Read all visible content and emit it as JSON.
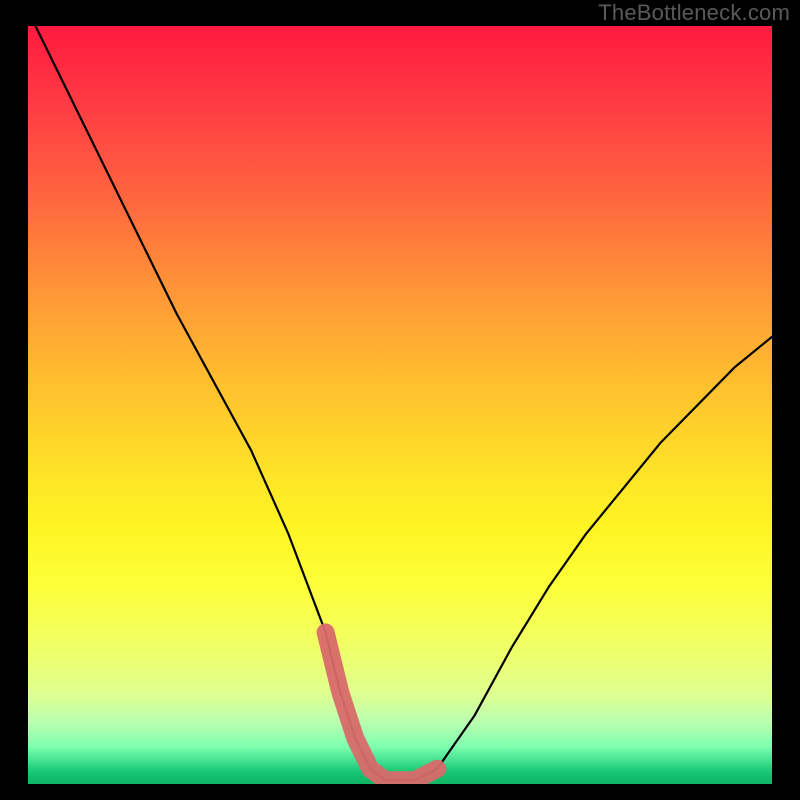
{
  "watermark": "TheBottleneck.com",
  "chart_data": {
    "type": "line",
    "title": "",
    "xlabel": "",
    "ylabel": "",
    "xlim": [
      0,
      100
    ],
    "ylim": [
      0,
      100
    ],
    "grid": false,
    "series": [
      {
        "name": "bottleneck-curve",
        "color": "#000000",
        "x": [
          0,
          5,
          10,
          15,
          20,
          25,
          30,
          35,
          40,
          42,
          44,
          46,
          48,
          50,
          52,
          55,
          60,
          65,
          70,
          75,
          80,
          85,
          90,
          95,
          100
        ],
        "values": [
          102,
          92,
          82,
          72,
          62,
          53,
          44,
          33,
          20,
          12,
          6,
          2,
          0.5,
          0.5,
          0.5,
          2,
          9,
          18,
          26,
          33,
          39,
          45,
          50,
          55,
          59
        ]
      },
      {
        "name": "highlight-band",
        "color": "#d86a6a",
        "x": [
          40,
          42,
          44,
          46,
          48,
          50,
          52,
          55
        ],
        "values": [
          20,
          12,
          6,
          2,
          0.5,
          0.5,
          0.5,
          2
        ]
      }
    ],
    "annotations": []
  },
  "colors": {
    "frame": "#000000",
    "curve": "#000000",
    "highlight": "#d86a6a"
  }
}
